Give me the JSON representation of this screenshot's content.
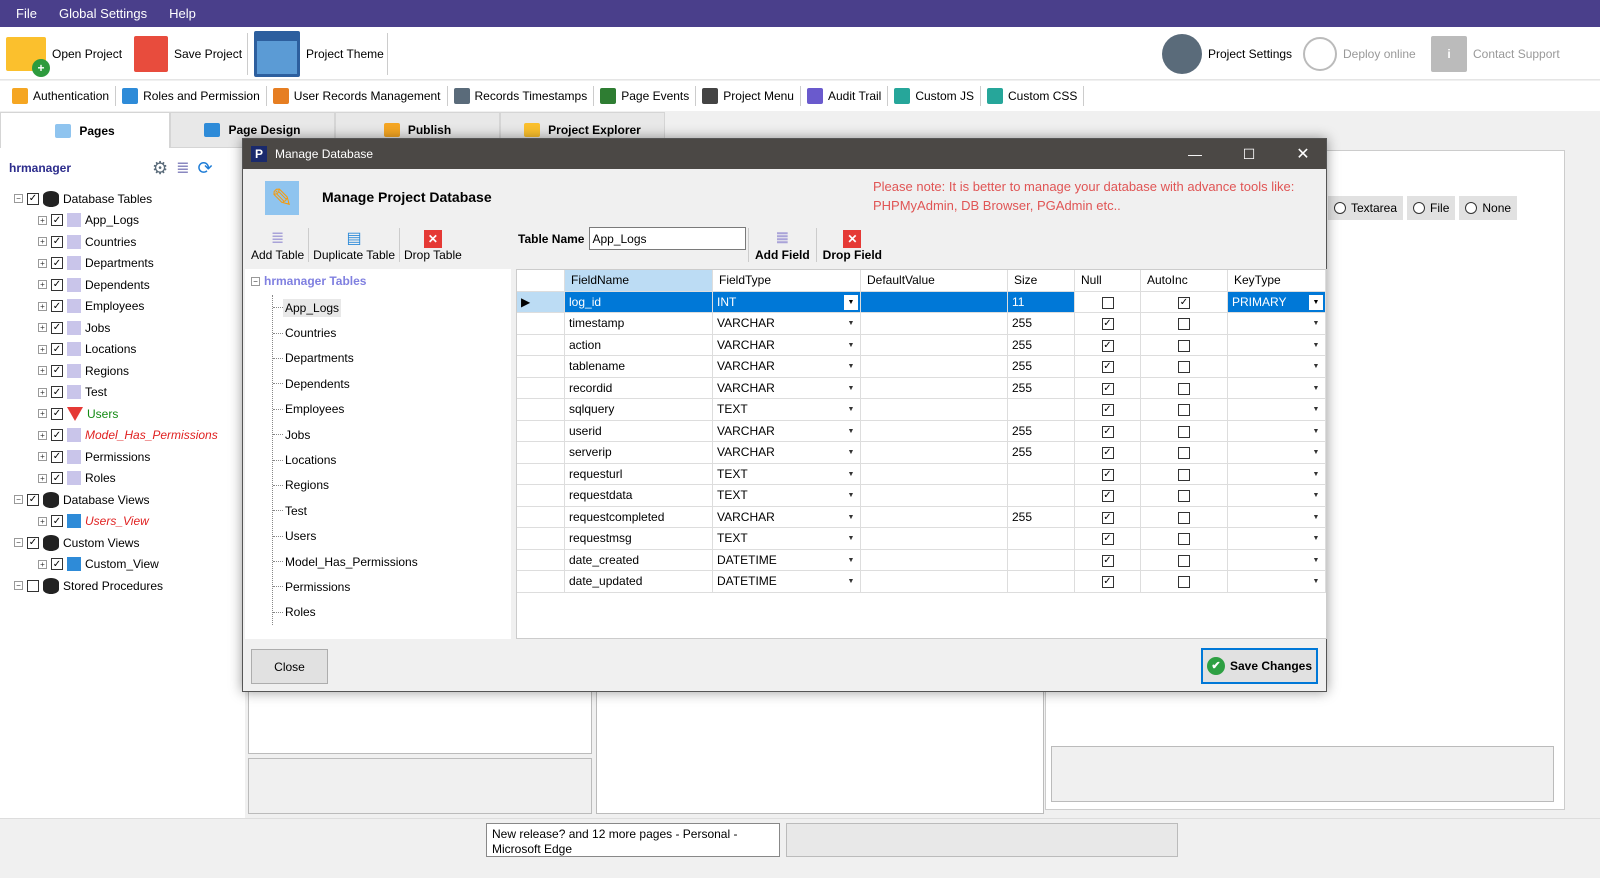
{
  "menu": [
    "File",
    "Global Settings",
    "Help"
  ],
  "toolbar": {
    "open": "Open Project",
    "save": "Save Project",
    "theme": "Project Theme",
    "settings": "Project Settings",
    "deploy": "Deploy online",
    "support": "Contact Support"
  },
  "toolbar2": [
    "Authentication",
    "Roles and Permission",
    "User Records Management",
    "Records Timestamps",
    "Page Events",
    "Project Menu",
    "Audit Trail",
    "Custom JS",
    "Custom CSS"
  ],
  "tabs": [
    "Pages",
    "Page Design",
    "Publish",
    "Project Explorer"
  ],
  "left": {
    "project": "hrmanager",
    "tree": [
      {
        "label": "Database Tables",
        "level": 0,
        "kind": "group"
      },
      {
        "label": "App_Logs",
        "level": 1
      },
      {
        "label": "Countries",
        "level": 1
      },
      {
        "label": "Departments",
        "level": 1
      },
      {
        "label": "Dependents",
        "level": 1
      },
      {
        "label": "Employees",
        "level": 1
      },
      {
        "label": "Jobs",
        "level": 1
      },
      {
        "label": "Locations",
        "level": 1
      },
      {
        "label": "Regions",
        "level": 1
      },
      {
        "label": "Test",
        "level": 1
      },
      {
        "label": "Users",
        "level": 1,
        "color": "#138a13",
        "icon": "filter"
      },
      {
        "label": "Model_Has_Permissions",
        "level": 1,
        "color": "#e02020",
        "italic": true
      },
      {
        "label": "Permissions",
        "level": 1
      },
      {
        "label": "Roles",
        "level": 1
      },
      {
        "label": "Database Views",
        "level": 0,
        "kind": "group"
      },
      {
        "label": "Users_View",
        "level": 1,
        "color": "#e02020",
        "italic": true,
        "icon": "view"
      },
      {
        "label": "Custom Views",
        "level": 0,
        "kind": "group"
      },
      {
        "label": "Custom_View",
        "level": 1,
        "icon": "view"
      },
      {
        "label": "Stored Procedures",
        "level": 0,
        "kind": "group",
        "unchecked": true
      }
    ]
  },
  "right_radio": [
    "Textarea",
    "File",
    "None"
  ],
  "modal": {
    "title": "Manage Database",
    "heading": "Manage Project Database",
    "note": "Please note: It is better to manage your database with advance tools like: PHPMyAdmin, DB Browser, PGAdmin etc..",
    "add_table": "Add Table",
    "duplicate_table": "Duplicate Table",
    "drop_table": "Drop Table",
    "tables_root": "hrmanager Tables",
    "tables": [
      "App_Logs",
      "Countries",
      "Departments",
      "Dependents",
      "Employees",
      "Jobs",
      "Locations",
      "Regions",
      "Test",
      "Users",
      "Model_Has_Permissions",
      "Permissions",
      "Roles"
    ],
    "table_name_label": "Table Name",
    "table_name": "App_Logs",
    "add_field": "Add Field",
    "drop_field": "Drop Field",
    "columns": [
      "FieldName",
      "FieldType",
      "DefaultValue",
      "Size",
      "Null",
      "AutoInc",
      "KeyType"
    ],
    "rows": [
      [
        "log_id",
        "INT",
        "",
        "11",
        false,
        true,
        "PRIMARY"
      ],
      [
        "timestamp",
        "VARCHAR",
        "",
        "255",
        true,
        false,
        ""
      ],
      [
        "action",
        "VARCHAR",
        "",
        "255",
        true,
        false,
        ""
      ],
      [
        "tablename",
        "VARCHAR",
        "",
        "255",
        true,
        false,
        ""
      ],
      [
        "recordid",
        "VARCHAR",
        "",
        "255",
        true,
        false,
        ""
      ],
      [
        "sqlquery",
        "TEXT",
        "",
        "",
        true,
        false,
        ""
      ],
      [
        "userid",
        "VARCHAR",
        "",
        "255",
        true,
        false,
        ""
      ],
      [
        "serverip",
        "VARCHAR",
        "",
        "255",
        true,
        false,
        ""
      ],
      [
        "requesturl",
        "TEXT",
        "",
        "",
        true,
        false,
        ""
      ],
      [
        "requestdata",
        "TEXT",
        "",
        "",
        true,
        false,
        ""
      ],
      [
        "requestcompleted",
        "VARCHAR",
        "",
        "255",
        true,
        false,
        ""
      ],
      [
        "requestmsg",
        "TEXT",
        "",
        "",
        true,
        false,
        ""
      ],
      [
        "date_created",
        "DATETIME",
        "",
        "",
        true,
        false,
        ""
      ],
      [
        "date_updated",
        "DATETIME",
        "",
        "",
        true,
        false,
        ""
      ]
    ],
    "close": "Close",
    "save": "Save Changes"
  },
  "taskbar_tooltip": "New release? and 12 more pages - Personal - Microsoft Edge",
  "colors": {
    "menubar": "#4a3f8b",
    "selected_row": "#0078d7",
    "note": "#e05555"
  }
}
